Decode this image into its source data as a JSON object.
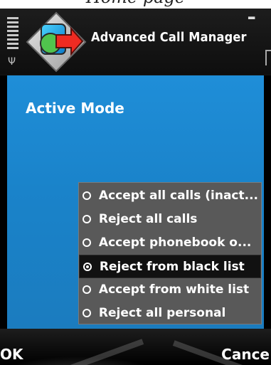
{
  "overlay": {
    "text": "Home page"
  },
  "header": {
    "app_title": "Advanced Call Manager",
    "icons": {
      "signal": "signal-bars-icon",
      "antenna": "antenna-icon",
      "app": "advanced-call-manager-app-icon",
      "battery": "battery-icon"
    }
  },
  "main": {
    "title": "Active Mode",
    "options": [
      {
        "label": "Accept all calls (inact...",
        "selected": false
      },
      {
        "label": "Reject all calls",
        "selected": false
      },
      {
        "label": "Accept phonebook o...",
        "selected": false
      },
      {
        "label": "Reject from black list",
        "selected": true
      },
      {
        "label": "Accept from white list",
        "selected": false
      },
      {
        "label": "Reject all personal",
        "selected": false
      }
    ]
  },
  "softkeys": {
    "left": "OK",
    "right": "Cance"
  },
  "colors": {
    "main_blue": "#1b86cf",
    "list_gray": "#595959",
    "selected_row": "#111111",
    "text": "#ffffff"
  }
}
